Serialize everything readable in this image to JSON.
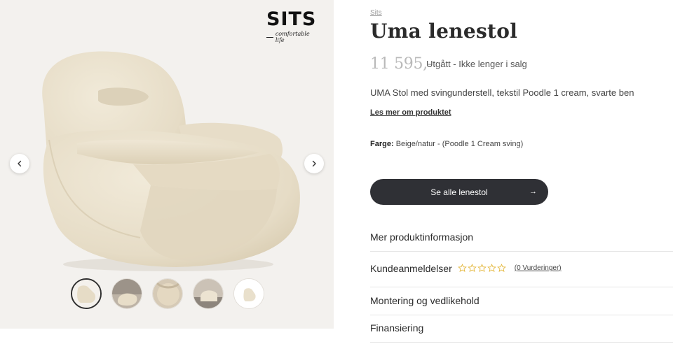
{
  "brand": {
    "logo_text": "SITS",
    "tagline": "comfortable life"
  },
  "gallery": {
    "prev_icon": "chevron-left-icon",
    "next_icon": "chevron-right-icon",
    "thumbnail_count": 5,
    "active_thumbnail": 1
  },
  "product": {
    "breadcrumb": "Sits",
    "title": "Uma lenestol",
    "price": "11 595,-",
    "status": "Utgått - Ikke lenger i salg",
    "description": "UMA Stol med svingunderstell, tekstil Poodle 1 cream, svarte ben",
    "read_more": "Les mer om produktet",
    "color_label": "Farge:",
    "color_value": "Beige/natur - (Poodle 1 Cream sving)",
    "cta_label": "Se alle lenestol",
    "cta_arrow": "→"
  },
  "accordion": {
    "item1": "Mer produktinformasjon",
    "item2": "Kundeanmeldelser",
    "reviews_link": "(0 Vurderinger)",
    "rating_stars": 0,
    "rating_max": 5,
    "item3": "Montering og vedlikehold",
    "item4": "Finansiering"
  },
  "colors": {
    "gallery_bg": "#f3f1ee",
    "cta_bg": "#2f3035",
    "star_color": "#e3b63a",
    "chair_fabric": "#e9e0cd"
  }
}
